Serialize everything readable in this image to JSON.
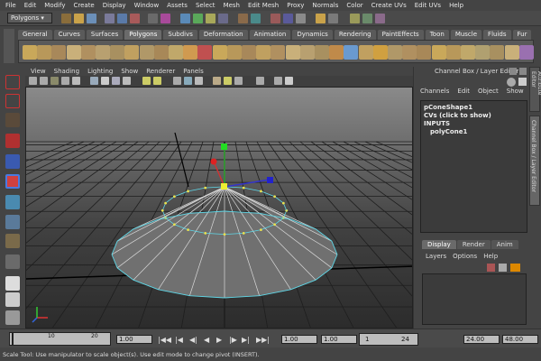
{
  "menubar": [
    "File",
    "Edit",
    "Modify",
    "Create",
    "Display",
    "Window",
    "Assets",
    "Select",
    "Mesh",
    "Edit Mesh",
    "Proxy",
    "Normals",
    "Color",
    "Create UVs",
    "Edit UVs",
    "Help"
  ],
  "mode_selector": "Polygons",
  "shelf_tabs": [
    {
      "label": "General"
    },
    {
      "label": "Curves"
    },
    {
      "label": "Surfaces"
    },
    {
      "label": "Polygons",
      "active": true
    },
    {
      "label": "Subdivs"
    },
    {
      "label": "Deformation"
    },
    {
      "label": "Animation"
    },
    {
      "label": "Dynamics"
    },
    {
      "label": "Rendering"
    },
    {
      "label": "PaintEffects"
    },
    {
      "label": "Toon"
    },
    {
      "label": "Muscle"
    },
    {
      "label": "Fluids"
    },
    {
      "label": "Fur"
    }
  ],
  "viewport_menu": [
    "View",
    "Shading",
    "Lighting",
    "Show",
    "Renderer",
    "Panels"
  ],
  "channel_box": {
    "header": "Channel Box / Layer Editor",
    "menu": [
      "Channels",
      "Edit",
      "Object",
      "Show"
    ],
    "shape_name": "pConeShape1",
    "cvs_label": "CVs (click to show)",
    "inputs_label": "INPUTS",
    "input_node": "polyCone1"
  },
  "side_tabs": [
    "Attribute Editor",
    "Channel Box / Layer Editor"
  ],
  "layer_editor": {
    "tabs": [
      {
        "label": "Display",
        "active": true
      },
      {
        "label": "Render"
      },
      {
        "label": "Anim"
      }
    ],
    "menu": [
      "Layers",
      "Options",
      "Help"
    ]
  },
  "timeline": {
    "ticks": [
      "10",
      "20"
    ],
    "current_time": "1.00",
    "range_start": "1.00",
    "range_start_inner": "1.00",
    "range_end_inner": "24",
    "range_end": "24.00",
    "max_end": "48.00",
    "range_field_value": "1"
  },
  "help_line": "Scale Tool: Use manipulator to scale object(s). Use edit mode to change pivot (INSERT)."
}
